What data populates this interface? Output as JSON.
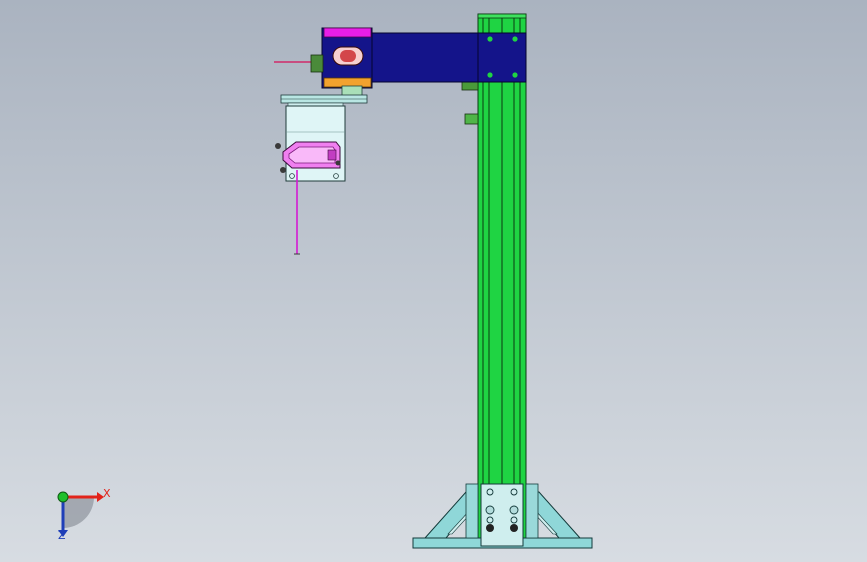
{
  "viewport": {
    "background_top": "#aab3c0",
    "background_bottom": "#d7dce2"
  },
  "triad": {
    "x_label": "X",
    "z_label": "Z",
    "x_color": "#e2231a",
    "y_color": "#1fbf2b",
    "z_color": "#1f3fb8"
  },
  "parts": {
    "column_color": "#1fd443",
    "arm_color": "#14148a",
    "clamp_top_color": "#e81ee8",
    "clamp_bottom_color": "#f2a22e",
    "sensor_color": "#f07ff0",
    "bracket_color": "#dff5f6",
    "base_color": "#8fd7d8",
    "laser_color": "#d41ad4"
  }
}
